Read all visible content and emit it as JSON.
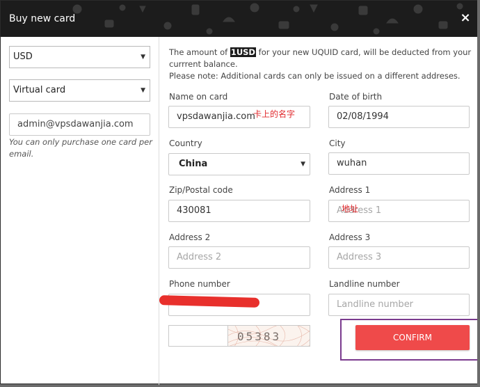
{
  "modal": {
    "title": "Buy new card",
    "close_icon": "×"
  },
  "sidebar": {
    "currency": "USD",
    "card_type": "Virtual card",
    "email": "admin@vpsdawanjia.com",
    "email_note": "You can only purchase one card per email."
  },
  "info": {
    "line_before": "The amount of ",
    "amount": "1USD",
    "line_after": " for your new UQUID card, will be deducted from your currrent balance.",
    "note": "Please note: Additional cards can only be issued on a different addreses."
  },
  "form": {
    "name_label": "Name on card",
    "name_value": "vpsdawanjia.com",
    "name_annotation": "卡上的名字",
    "dob_label": "Date of birth",
    "dob_value": "02/08/1994",
    "country_label": "Country",
    "country_value": "China",
    "city_label": "City",
    "city_value": "wuhan",
    "zip_label": "Zip/Postal code",
    "zip_value": "430081",
    "address1_label": "Address 1",
    "address1_placeholder": "Address 1",
    "address1_annotation": "地址",
    "address2_label": "Address 2",
    "address2_placeholder": "Address 2",
    "address3_label": "Address 3",
    "address3_placeholder": "Address 3",
    "phone_label": "Phone number",
    "landline_label": "Landline number",
    "landline_placeholder": "Landline number",
    "captcha_text": "05383",
    "confirm_label": "CONFIRM"
  },
  "colors": {
    "header_bg": "#1c1c1c",
    "confirm_bg": "#ef4a4a",
    "annotation_red": "#e0282c",
    "highlight_frame": "#7a3a8e"
  }
}
